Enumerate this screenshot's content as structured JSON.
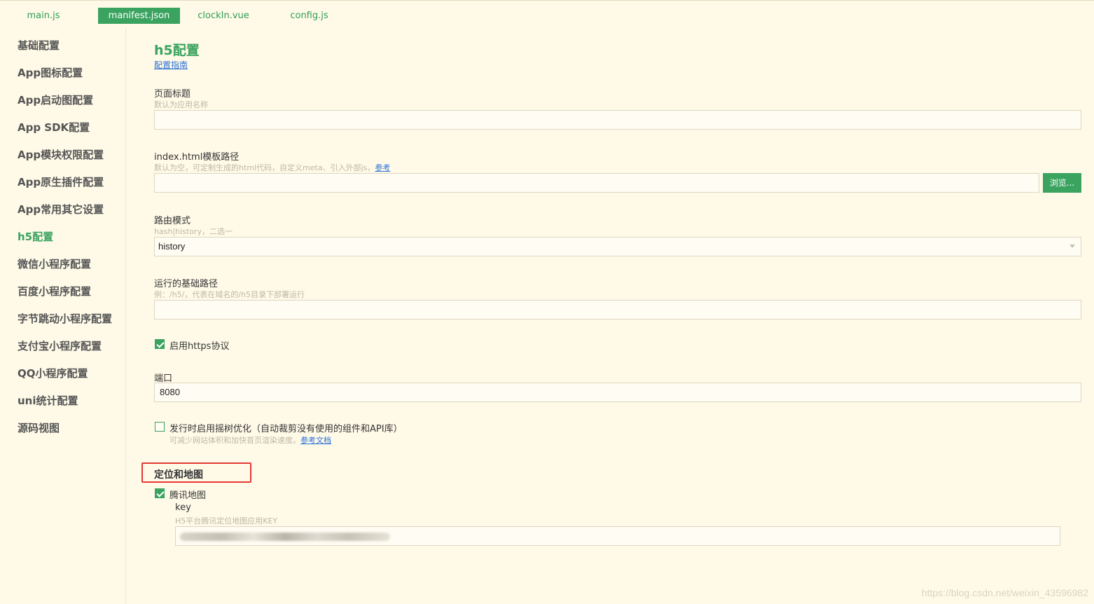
{
  "tabs": [
    {
      "label": "main.js",
      "active": false
    },
    {
      "label": "manifest.json",
      "active": true
    },
    {
      "label": "clockIn.vue",
      "active": false
    },
    {
      "label": "config.js",
      "active": false
    }
  ],
  "sidebar": {
    "items": [
      {
        "label": "基础配置"
      },
      {
        "label": "App图标配置"
      },
      {
        "label": "App启动图配置"
      },
      {
        "label": "App SDK配置"
      },
      {
        "label": "App模块权限配置"
      },
      {
        "label": "App原生插件配置"
      },
      {
        "label": "App常用其它设置"
      },
      {
        "label": "h5配置",
        "active": true
      },
      {
        "label": "微信小程序配置"
      },
      {
        "label": "百度小程序配置"
      },
      {
        "label": "字节跳动小程序配置"
      },
      {
        "label": "支付宝小程序配置"
      },
      {
        "label": "QQ小程序配置"
      },
      {
        "label": "uni统计配置"
      },
      {
        "label": "源码视图"
      }
    ]
  },
  "main": {
    "title": "h5配置",
    "guide_link": "配置指南",
    "page_title_field": {
      "label": "页面标题",
      "hint": "默认为应用名称",
      "value": ""
    },
    "template_field": {
      "label": "index.html模板路径",
      "hint": "默认为空，可定制生成的html代码，自定义meta、引入外部js，",
      "hint_link": "参考",
      "value": "",
      "browse_label": "浏览..."
    },
    "router_field": {
      "label": "路由模式",
      "hint": "hash|history，二选一",
      "value": "history"
    },
    "base_path_field": {
      "label": "运行的基础路径",
      "hint": "例：/h5/，代表在域名的/h5目录下部署运行",
      "value": ""
    },
    "https_checkbox": {
      "label": "启用https协议",
      "checked": true
    },
    "port_field": {
      "label": "端口",
      "value": "8080"
    },
    "treeshake_checkbox": {
      "label": "发行时启用摇树优化（自动裁剪没有使用的组件和API库）",
      "checked": false,
      "hint": "可减少网站体积和加快首页渲染速度。",
      "hint_link": "参考文档"
    },
    "location_section": {
      "title": "定位和地图",
      "tencent_checkbox": {
        "label": "腾讯地图",
        "checked": true
      },
      "key_label": "key",
      "key_hint": "H5平台腾讯定位地图应用KEY"
    }
  },
  "watermark": "https://blog.csdn.net/weixin_43596982",
  "colors": {
    "accent": "#3aa35f",
    "background": "#fffae8",
    "link": "#2a6fd6",
    "highlight_box": "#e53935"
  }
}
